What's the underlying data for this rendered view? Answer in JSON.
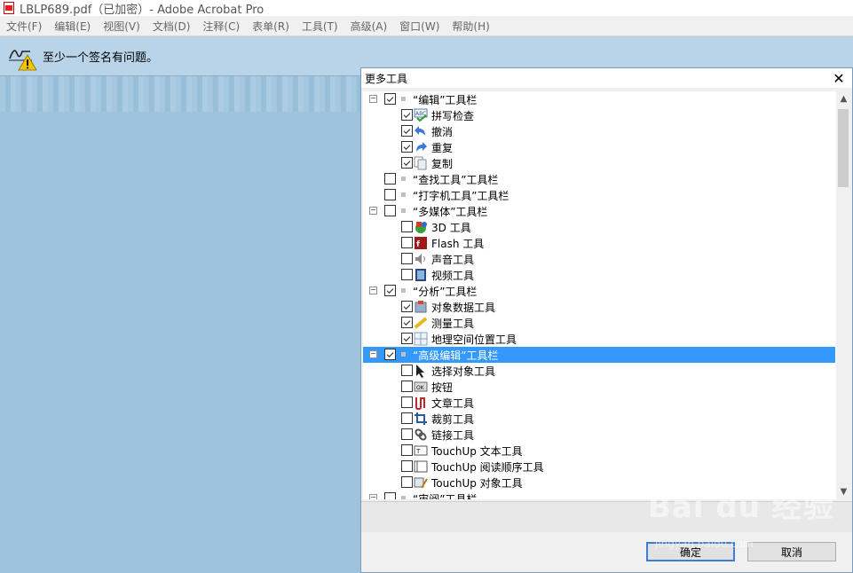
{
  "window": {
    "title": "LBLP689.pdf（已加密）- Adobe Acrobat Pro"
  },
  "menu": [
    "文件(F)",
    "编辑(E)",
    "视图(V)",
    "文档(D)",
    "注释(C)",
    "表单(R)",
    "工具(T)",
    "高级(A)",
    "窗口(W)",
    "帮助(H)"
  ],
  "warning": {
    "text": "至少一个签名有问题。"
  },
  "dialog": {
    "title": "更多工具",
    "ok_label": "确定",
    "cancel_label": "取消",
    "rows": [
      {
        "level": 0,
        "expander": "−",
        "checked": true,
        "label": "“编辑”工具栏"
      },
      {
        "level": 1,
        "checked": true,
        "icon": "spellcheck-icon",
        "label": "拼写检查"
      },
      {
        "level": 1,
        "checked": true,
        "icon": "undo-icon",
        "label": "撤消"
      },
      {
        "level": 1,
        "checked": true,
        "icon": "redo-icon",
        "label": "重复"
      },
      {
        "level": 1,
        "checked": true,
        "icon": "copy-icon",
        "label": "复制"
      },
      {
        "level": 0,
        "expander": "",
        "checked": false,
        "label": "“查找工具”工具栏"
      },
      {
        "level": 0,
        "expander": "",
        "checked": false,
        "label": "“打字机工具”工具栏"
      },
      {
        "level": 0,
        "expander": "−",
        "checked": false,
        "label": "“多媒体”工具栏"
      },
      {
        "level": 1,
        "checked": false,
        "icon": "3d-icon",
        "label": "3D 工具"
      },
      {
        "level": 1,
        "checked": false,
        "icon": "flash-icon",
        "label": "Flash 工具"
      },
      {
        "level": 1,
        "checked": false,
        "icon": "sound-icon",
        "label": "声音工具"
      },
      {
        "level": 1,
        "checked": false,
        "icon": "video-icon",
        "label": "视频工具"
      },
      {
        "level": 0,
        "expander": "−",
        "checked": true,
        "label": "“分析”工具栏"
      },
      {
        "level": 1,
        "checked": true,
        "icon": "object-data-icon",
        "label": "对象数据工具"
      },
      {
        "level": 1,
        "checked": true,
        "icon": "measure-icon",
        "label": "测量工具"
      },
      {
        "level": 1,
        "checked": true,
        "icon": "geo-icon",
        "label": "地理空间位置工具"
      },
      {
        "level": 0,
        "expander": "−",
        "checked": true,
        "label": "“高级编辑”工具栏",
        "selected": true
      },
      {
        "level": 1,
        "checked": false,
        "icon": "select-object-icon",
        "label": "选择对象工具"
      },
      {
        "level": 1,
        "checked": false,
        "icon": "button-icon",
        "label": "按钮"
      },
      {
        "level": 1,
        "checked": false,
        "icon": "article-icon",
        "label": "文章工具"
      },
      {
        "level": 1,
        "checked": false,
        "icon": "crop-icon",
        "label": "裁剪工具"
      },
      {
        "level": 1,
        "checked": false,
        "icon": "link-icon",
        "label": "链接工具"
      },
      {
        "level": 1,
        "checked": false,
        "icon": "touchup-text-icon",
        "label": "TouchUp 文本工具"
      },
      {
        "level": 1,
        "checked": false,
        "icon": "touchup-order-icon",
        "label": "TouchUp 阅读顺序工具"
      },
      {
        "level": 1,
        "checked": false,
        "icon": "touchup-object-icon",
        "label": "TouchUp 对象工具"
      },
      {
        "level": 0,
        "expander": "−",
        "checked": false,
        "label": "“审阅”工具栏"
      }
    ]
  },
  "watermark": {
    "text": "Bai du 经验",
    "sub": "jingyan.baidu.com"
  },
  "colors": {
    "selection": "#3399ff",
    "background": "#9ec3dc"
  }
}
